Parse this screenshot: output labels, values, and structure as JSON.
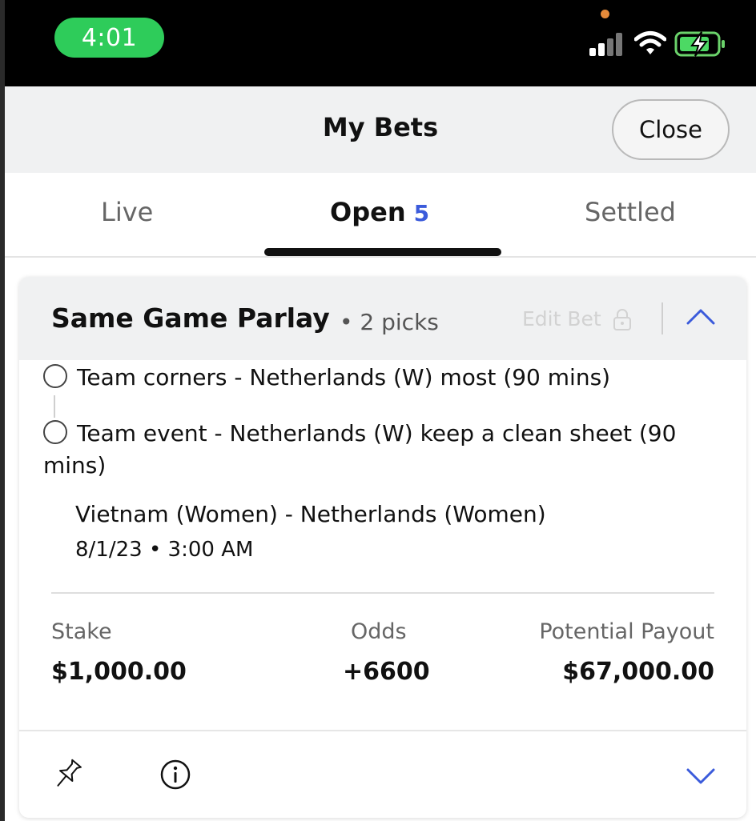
{
  "status_bar": {
    "time": "4:01"
  },
  "header": {
    "title": "My Bets",
    "close_label": "Close"
  },
  "tabs": {
    "live_label": "Live",
    "open_label": "Open",
    "open_count": "5",
    "settled_label": "Settled",
    "active": "Open"
  },
  "bet": {
    "type": "Same Game Parlay",
    "picks_count": "• 2 picks",
    "edit_label": "Edit Bet",
    "picks": [
      {
        "label": "Team corners - Netherlands (W) most (90 mins)"
      },
      {
        "label": "Team event - Netherlands (W) keep a clean sheet (90 mins)"
      }
    ],
    "match": "Vietnam (Women) - Netherlands (Women)",
    "date": "8/1/23 • 3:00 AM",
    "stake_label": "Stake",
    "stake_value": "$1,000.00",
    "odds_label": "Odds",
    "odds_value": "+6600",
    "payout_label": "Potential Payout",
    "payout_value": "$67,000.00"
  },
  "colors": {
    "status_pill": "#2ecc5a",
    "accent_blue": "#3b5bdb",
    "header_bg": "#f0f1f2"
  }
}
